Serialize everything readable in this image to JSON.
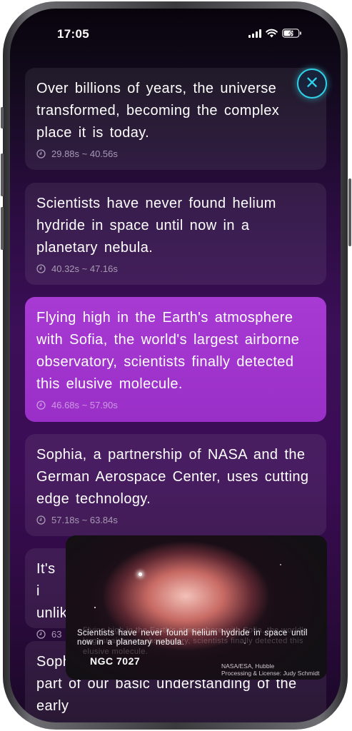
{
  "status_bar": {
    "time": "17:05"
  },
  "close_button": {
    "icon": "close-icon",
    "glyph": "✕"
  },
  "cards": [
    {
      "text": "Over billions of years, the universe transformed, becoming the complex place it is today.",
      "time": "29.88s ~ 40.56s"
    },
    {
      "text": "Scientists have never found helium hydride in space until now in a planetary nebula.",
      "time": "40.32s ~ 47.16s"
    },
    {
      "text": "Flying high in the Earth's atmosphere with Sofia, the world's largest airborne observatory, scientists finally detected this elusive molecule.",
      "time": "46.68s ~ 57.90s",
      "active": true
    },
    {
      "text": "Sophia, a partnership of NASA and the German Aerospace Center, uses cutting edge technology.",
      "time": "57.18s ~ 63.84s"
    },
    {
      "text": "It's i unlik",
      "time": "63"
    },
    {
      "text": "Soph that ever formed confirms a key part of our basic understanding of the early",
      "time": ""
    }
  ],
  "video": {
    "ghost_caption": "Flying high in the Earth's atmosphere with Sofia, the world's largest airborne observatory, scientists finally detected this elusive molecule.",
    "caption": "Scientists have never found helium hydride in space until now in a planetary nebula.",
    "label": "NGC 7027",
    "credit_line1": "NASA/ESA, Hubble",
    "credit_line2": "Processing & License: Judy Schmidt"
  },
  "colors": {
    "accent": "#2fd2e8",
    "active_card": "#a73ad2"
  }
}
